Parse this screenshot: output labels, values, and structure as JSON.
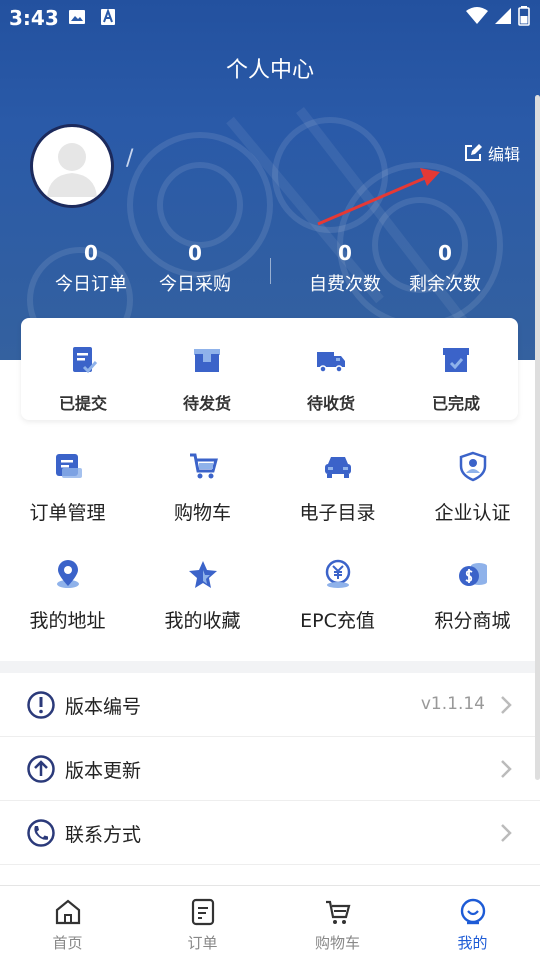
{
  "status_bar": {
    "time": "3:43"
  },
  "header": {
    "title": "个人中心",
    "user_name": "/",
    "edit_label": "编辑"
  },
  "stats": [
    {
      "value": "0",
      "label": "今日订单"
    },
    {
      "value": "0",
      "label": "今日采购"
    },
    {
      "value": "0",
      "label": "自费次数"
    },
    {
      "value": "0",
      "label": "剩余次数"
    }
  ],
  "order_status": [
    {
      "label": "已提交",
      "icon": "submitted-icon"
    },
    {
      "label": "待发货",
      "icon": "to-ship-icon"
    },
    {
      "label": "待收货",
      "icon": "to-receive-icon"
    },
    {
      "label": "已完成",
      "icon": "completed-icon"
    }
  ],
  "grid": [
    {
      "label": "订单管理",
      "icon": "order-management-icon"
    },
    {
      "label": "购物车",
      "icon": "cart-icon"
    },
    {
      "label": "电子目录",
      "icon": "car-catalog-icon"
    },
    {
      "label": "企业认证",
      "icon": "certification-icon"
    },
    {
      "label": "我的地址",
      "icon": "location-icon"
    },
    {
      "label": "我的收藏",
      "icon": "star-icon"
    },
    {
      "label": "EPC充值",
      "icon": "recharge-icon"
    },
    {
      "label": "积分商城",
      "icon": "coins-icon"
    }
  ],
  "rows": [
    {
      "label": "版本编号",
      "value": "v1.1.14",
      "icon": "info-icon"
    },
    {
      "label": "版本更新",
      "value": "",
      "icon": "upload-icon"
    },
    {
      "label": "联系方式",
      "value": "",
      "icon": "phone-icon"
    }
  ],
  "bottom_nav": [
    {
      "label": "首页",
      "icon": "home-icon",
      "active": false
    },
    {
      "label": "订单",
      "icon": "order-icon",
      "active": false
    },
    {
      "label": "购物车",
      "icon": "cart-icon",
      "active": false
    },
    {
      "label": "我的",
      "icon": "profile-icon",
      "active": true
    }
  ],
  "colors": {
    "header_bg": "#2a5aa8",
    "accent": "#1d5bd6",
    "icon_blue": "#3b63c9",
    "icon_light": "#8fb2ea",
    "annotation_red": "#e53935"
  }
}
